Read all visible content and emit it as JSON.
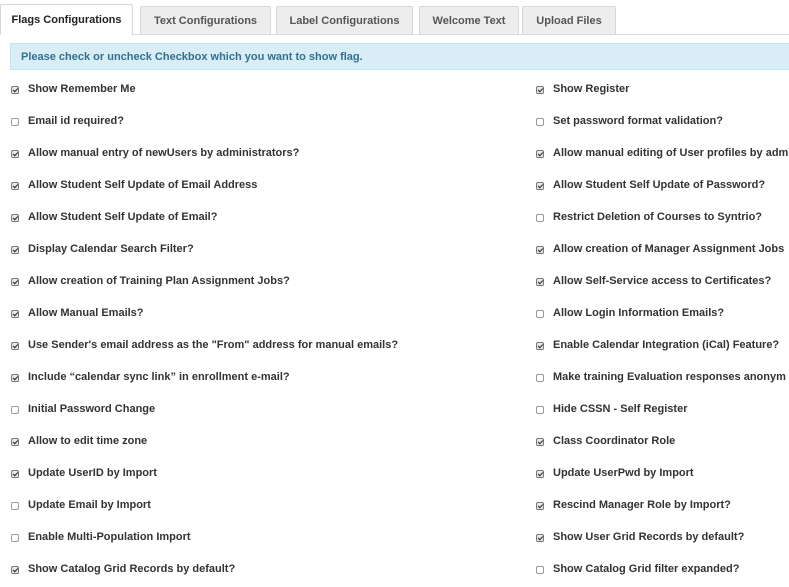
{
  "tabs": [
    {
      "label": "Flags Configurations",
      "active": true
    },
    {
      "label": "Text Configurations",
      "active": false
    },
    {
      "label": "Label Configurations",
      "active": false
    },
    {
      "label": "Welcome Text",
      "active": false
    },
    {
      "label": "Upload Files",
      "active": false
    }
  ],
  "info_message": "Please check or uncheck Checkbox which you want to show flag.",
  "flags_left": [
    {
      "label": "Show Remember Me",
      "checked": true
    },
    {
      "label": "Email id required?",
      "checked": false
    },
    {
      "label": "Allow manual entry of newUsers by administrators?",
      "checked": true
    },
    {
      "label": "Allow Student Self Update of Email Address",
      "checked": true
    },
    {
      "label": "Allow Student Self Update of Email?",
      "checked": true
    },
    {
      "label": "Display Calendar Search Filter?",
      "checked": true
    },
    {
      "label": "Allow creation of Training Plan Assignment Jobs?",
      "checked": true
    },
    {
      "label": "Allow Manual Emails?",
      "checked": true
    },
    {
      "label": "Use Sender's email address as the \"From\" address for manual emails?",
      "checked": true
    },
    {
      "label": "Include “calendar sync link” in enrollment e-mail?",
      "checked": true
    },
    {
      "label": "Initial Password Change",
      "checked": false
    },
    {
      "label": "Allow to edit time zone",
      "checked": true
    },
    {
      "label": "Update UserID by Import",
      "checked": true
    },
    {
      "label": "Update Email by Import",
      "checked": false
    },
    {
      "label": "Enable Multi-Population Import",
      "checked": false
    },
    {
      "label": "Show Catalog Grid Records by default?",
      "checked": true
    }
  ],
  "flags_right": [
    {
      "label": "Show Register",
      "checked": true
    },
    {
      "label": "Set password format validation?",
      "checked": false
    },
    {
      "label": "Allow manual editing of User profiles by adm",
      "checked": true
    },
    {
      "label": "Allow Student Self Update of Password?",
      "checked": true
    },
    {
      "label": "Restrict Deletion of Courses to Syntrio?",
      "checked": false
    },
    {
      "label": "Allow creation of Manager Assignment Jobs",
      "checked": true
    },
    {
      "label": "Allow Self-Service access to Certificates?",
      "checked": true
    },
    {
      "label": "Allow Login Information Emails?",
      "checked": false
    },
    {
      "label": "Enable Calendar Integration (iCal) Feature?",
      "checked": true
    },
    {
      "label": "Make training Evaluation responses anonym",
      "checked": false
    },
    {
      "label": "Hide CSSN - Self Register",
      "checked": false
    },
    {
      "label": "Class Coordinator Role",
      "checked": true
    },
    {
      "label": "Update UserPwd by Import",
      "checked": true
    },
    {
      "label": "Rescind Manager Role by Import?",
      "checked": true
    },
    {
      "label": "Show User Grid Records by default?",
      "checked": true
    },
    {
      "label": "Show Catalog Grid filter expanded?",
      "checked": false
    }
  ]
}
